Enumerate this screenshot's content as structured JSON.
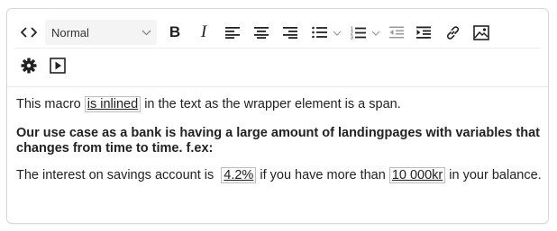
{
  "toolbar": {
    "format_select_value": "Normal",
    "buttons": [
      {
        "name": "code-view-button",
        "icon": "code-icon"
      },
      {
        "name": "bold-button",
        "icon": "bold-icon",
        "label": "B"
      },
      {
        "name": "italic-button",
        "icon": "italic-icon",
        "label": "I"
      },
      {
        "name": "align-left-button",
        "icon": "align-left-icon"
      },
      {
        "name": "align-center-button",
        "icon": "align-center-icon"
      },
      {
        "name": "align-right-button",
        "icon": "align-right-icon"
      },
      {
        "name": "bullet-list-button",
        "icon": "bullet-list-icon"
      },
      {
        "name": "numbered-list-button",
        "icon": "numbered-list-icon"
      },
      {
        "name": "outdent-button",
        "icon": "outdent-icon"
      },
      {
        "name": "indent-button",
        "icon": "indent-icon"
      },
      {
        "name": "link-button",
        "icon": "link-icon"
      },
      {
        "name": "image-button",
        "icon": "image-icon"
      },
      {
        "name": "settings-button",
        "icon": "gear-icon"
      },
      {
        "name": "media-button",
        "icon": "play-icon"
      }
    ]
  },
  "content": {
    "p1_before": "This macro ",
    "p1_macro": "is inlined",
    "p1_after": " in the text as the wrapper element is a span.",
    "p2": "Our use case as a bank is having a large amount of landingpages with variables that changes from time to time. f.ex:",
    "p3_before": "The interest on savings account is ",
    "p3_macro1": "4.2%",
    "p3_middle": " if you have more than ",
    "p3_macro2": "10 000kr",
    "p3_after": " in your balance."
  }
}
